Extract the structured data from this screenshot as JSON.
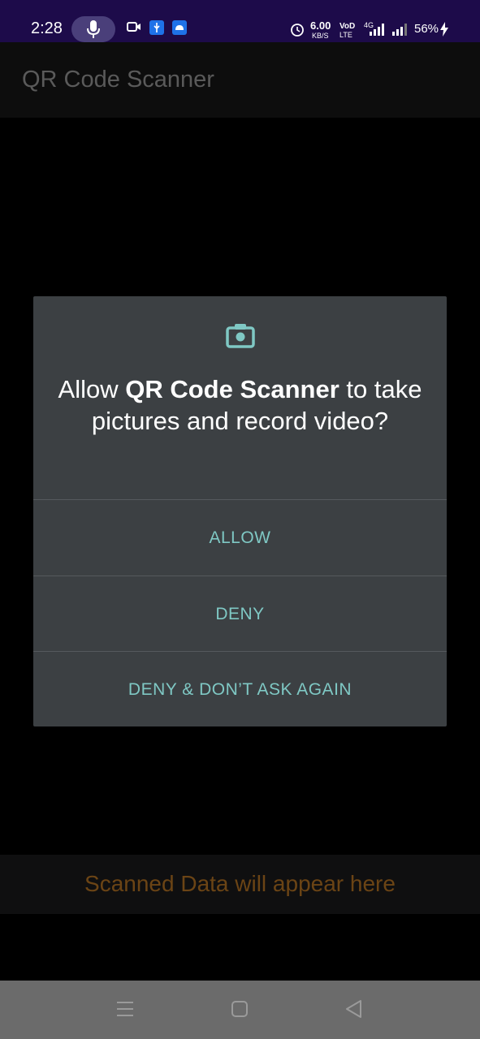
{
  "status_bar": {
    "time": "2:28",
    "net_speed": "6.00",
    "net_unit": "KB/S",
    "volte_top": "VoD",
    "volte_bottom": "LTE",
    "network": "4G",
    "battery": "56%",
    "icons": [
      "mic-icon",
      "video-camera-icon",
      "usb-icon",
      "android-icon",
      "alarm-icon",
      "signal-icon",
      "signal-icon-2",
      "charging-bolt-icon"
    ]
  },
  "app_bar": {
    "title": "QR Code Scanner"
  },
  "permission_dialog": {
    "icon": "camera-icon",
    "msg_prefix": "Allow ",
    "msg_app": "QR Code Scanner",
    "msg_suffix": " to take pictures and record video?",
    "allow_label": "ALLOW",
    "deny_label": "DENY",
    "deny_never_label": "DENY & DON’T ASK AGAIN",
    "accent_color": "#7fc8c4"
  },
  "scanned_panel": {
    "text": "Scanned Data will appear here",
    "text_color": "#6b4415"
  },
  "nav_bar": {
    "buttons": [
      "menu-icon",
      "home-icon",
      "back-icon"
    ]
  }
}
